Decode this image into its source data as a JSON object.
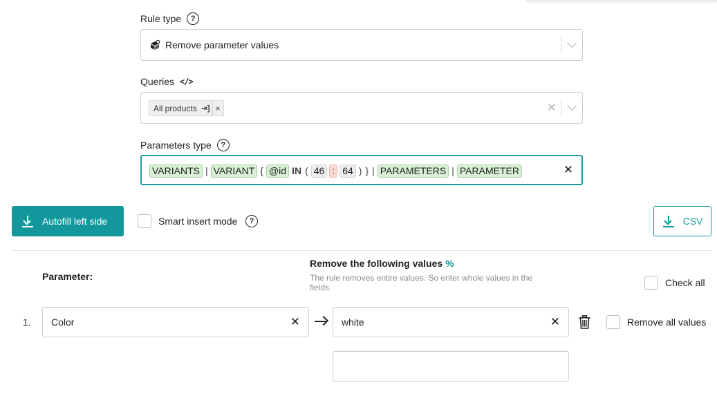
{
  "rule_type": {
    "label": "Rule type",
    "value": "Remove parameter values",
    "icon": "remove-values-icon"
  },
  "queries": {
    "label": "Queries",
    "chip_label": "All products",
    "chip_icon": "enter-arrow-icon",
    "chip_remove": "×"
  },
  "parameters_type": {
    "label": "Parameters type",
    "tokens": {
      "t1": "VARIANTS",
      "sep1": "|",
      "t2": "VARIANT",
      "brace_open": "{",
      "t3": "@id",
      "kw": "IN",
      "paren_open": "(",
      "n1": "46",
      "colon": ":",
      "n2": "64",
      "paren_close": ")",
      "brace_close": "}",
      "sep2": "|",
      "t4": "PARAMETERS",
      "sep3": "|",
      "t5": "PARAMETER"
    }
  },
  "toolbar": {
    "autofill_label": "Autofill left side",
    "smart_insert_label": "Smart insert mode",
    "csv_label": "CSV"
  },
  "table": {
    "parameter_header": "Parameter:",
    "values_header": "Remove the following values",
    "values_header_suffix": "%",
    "values_note": "The rule removes entire values. So enter whole values in the fields.",
    "check_all_label": "Check all",
    "rows": [
      {
        "number": "1.",
        "parameter": "Color",
        "value": "white",
        "remove_all_label": "Remove all values"
      }
    ]
  },
  "colors": {
    "accent": "#13979c",
    "token_bg": "#d9efd6"
  }
}
